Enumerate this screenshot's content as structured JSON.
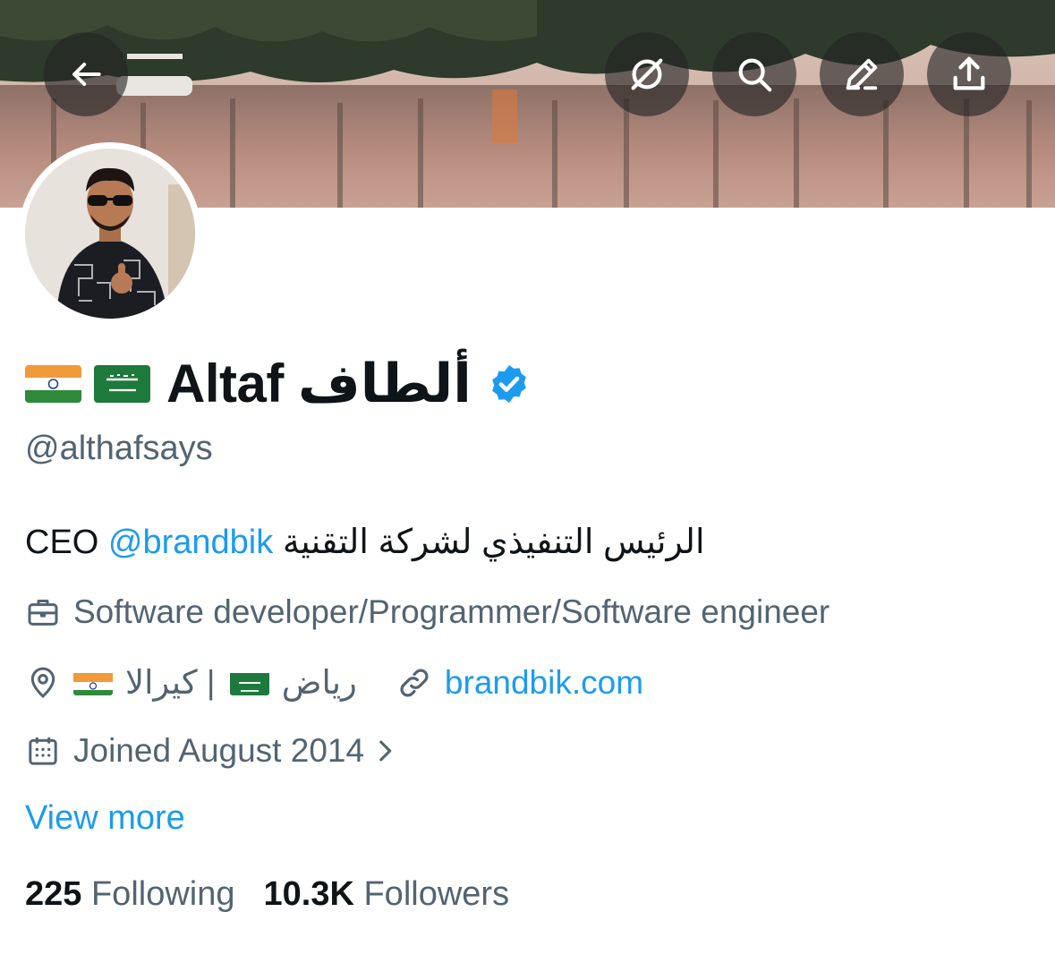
{
  "header": {
    "back_icon": "arrow-left-icon",
    "actions": [
      "grok-icon",
      "search-icon",
      "edit-icon",
      "share-icon"
    ]
  },
  "profile": {
    "display_name": "Altaf ألطاف",
    "flags": [
      "india-flag",
      "saudi-flag"
    ],
    "verified": true,
    "handle": "@althafsays",
    "bio_prefix": "CEO ",
    "bio_mention": "@brandbik",
    "bio_suffix": " الرئيس التنفيذي لشركة التقنية",
    "category": "Software developer/Programmer/Software engineer",
    "location_part1": "رياض",
    "location_sep": " | ",
    "location_part2": "كيرالا",
    "website": "brandbik.com",
    "joined": "Joined August 2014",
    "view_more": "View more"
  },
  "stats": {
    "following_count": "225",
    "following_label": "Following",
    "followers_count": "10.3K",
    "followers_label": "Followers"
  },
  "colors": {
    "accent": "#1d9bf0",
    "secondary_text": "#536471",
    "primary_text": "#0f1419"
  }
}
